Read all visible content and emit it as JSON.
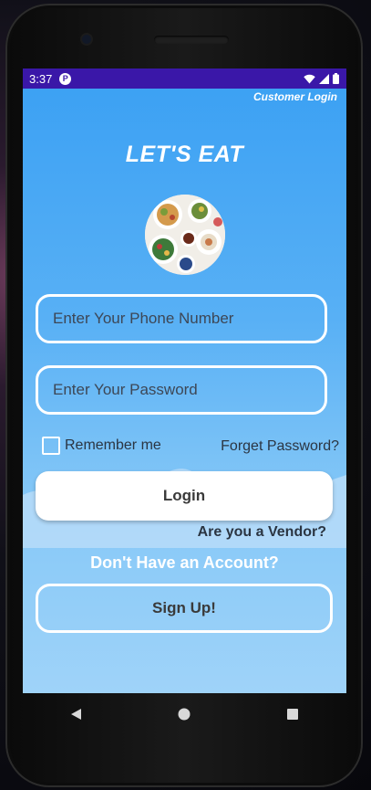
{
  "status_bar": {
    "time": "3:37",
    "app_icon_letter": "P",
    "icons": [
      "wifi-icon",
      "signal-icon",
      "battery-icon"
    ]
  },
  "header": {
    "top_label": "Customer Login",
    "app_title": "LET'S EAT"
  },
  "form": {
    "phone_placeholder": "Enter Your Phone Number",
    "password_placeholder": "Enter Your Password",
    "remember_label": "Remember me",
    "remember_checked": false,
    "forgot_link": "Forget Password?"
  },
  "actions": {
    "login_label": "Login",
    "vendor_link": "Are you a Vendor?",
    "no_account_text": "Don't Have an Account?",
    "signup_label": "Sign Up!"
  },
  "navigation": {
    "buttons": [
      "back-icon",
      "home-icon",
      "recents-icon"
    ]
  },
  "colors": {
    "status_bar": "#3a17a8",
    "screen_top": "#3aa0f3",
    "screen_bottom": "#9fd3f9"
  }
}
